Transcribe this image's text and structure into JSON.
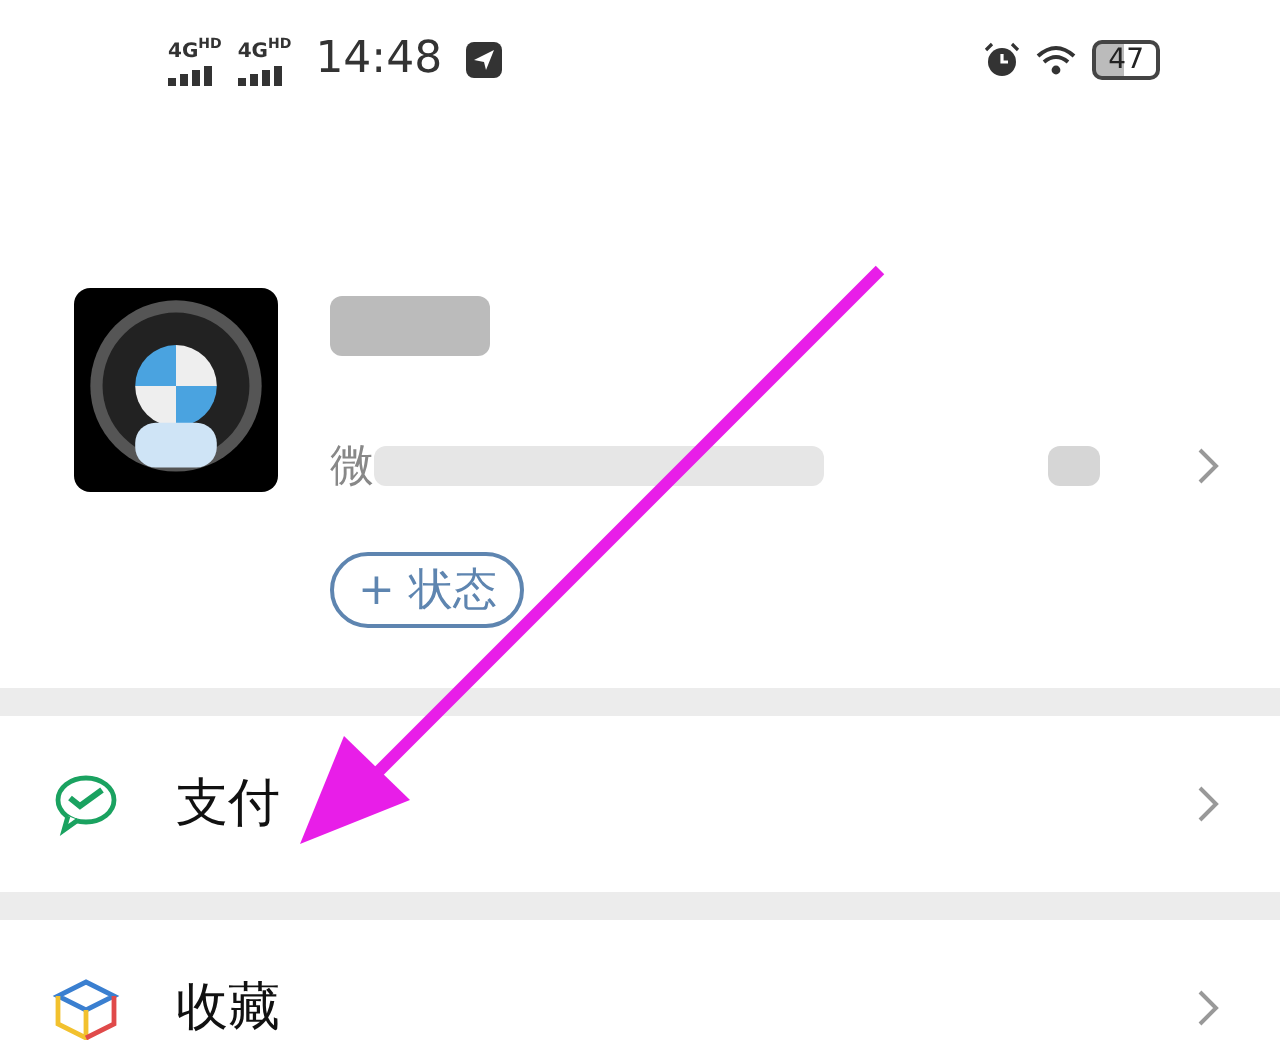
{
  "status_bar": {
    "networks": [
      {
        "label": "4G",
        "sub": "HD"
      },
      {
        "label": "4G",
        "sub": "HD"
      }
    ],
    "time": "14:48",
    "battery": "47"
  },
  "profile": {
    "id_prefix": "微",
    "status_button": "+ 状态"
  },
  "menu": [
    {
      "label": "支付",
      "kind": "pay"
    },
    {
      "label": "收藏",
      "kind": "favorites"
    }
  ]
}
